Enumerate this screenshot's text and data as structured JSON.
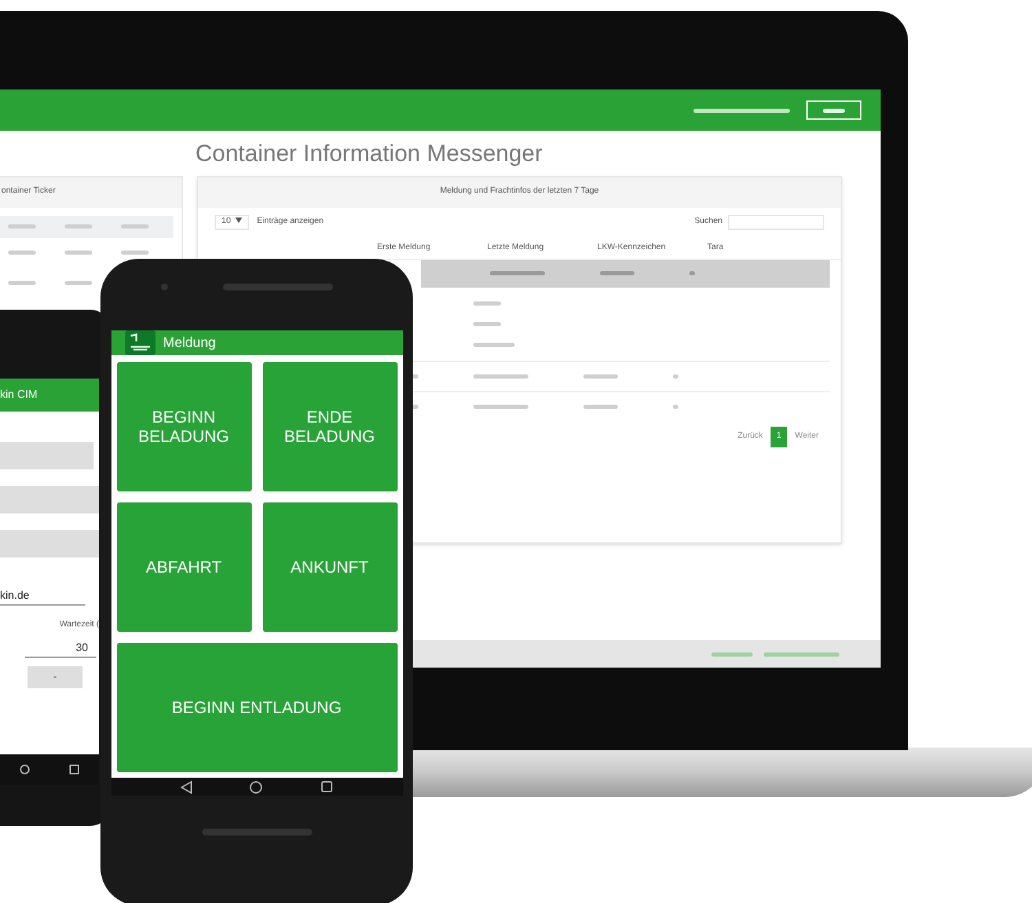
{
  "laptop": {
    "title": "Container Information Messenger",
    "ticker": {
      "title": "ontainer Ticker"
    },
    "messages": {
      "title": "Meldung und Frachtinfos der letzten 7 Tage",
      "page_size": "10",
      "entries_label": "Einträge anzeigen",
      "search_label": "Suchen",
      "columns": [
        "Erste Meldung",
        "Letzte Meldung",
        "LKW-Kennzeichen",
        "Tara"
      ],
      "pagination": [
        {
          "label": "Zurück",
          "selected": false
        },
        {
          "label": "1",
          "selected": true
        },
        {
          "label": "Weiter",
          "selected": false
        }
      ]
    }
  },
  "back_phone": {
    "title": "kin CIM",
    "email": "kin.de",
    "wait_label": "Wartezeit (",
    "wait_value": "30",
    "minus": "-"
  },
  "phone": {
    "title": "Meldung",
    "actions": [
      {
        "label": "BEGINN BELADUNG",
        "wide": false
      },
      {
        "label": "ENDE BELADUNG",
        "wide": false
      },
      {
        "label": "ABFAHRT",
        "wide": false
      },
      {
        "label": "ANKUNFT",
        "wide": false
      },
      {
        "label": "BEGINN ENTLADUNG",
        "wide": true
      }
    ]
  }
}
